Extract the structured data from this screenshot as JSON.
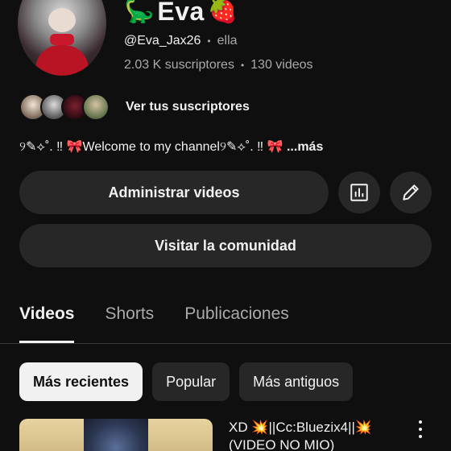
{
  "channel": {
    "name": "Eva",
    "emoji_left": "🦕",
    "emoji_right": "🍓",
    "handle": "@Eva_Jax26",
    "pronouns": "ella",
    "subscribers": "2.03 K suscriptores",
    "videos": "130 videos",
    "separator": "•"
  },
  "subscribers_preview": {
    "link_label": "Ver tus suscriptores"
  },
  "description": {
    "text": "୨✎⟡˚. ‼ 🎀Welcome to my channel୨✎⟡˚. ‼ 🎀",
    "more_label": "...más"
  },
  "buttons": {
    "manage": "Administrar videos",
    "analytics_icon": "analytics-icon",
    "edit_icon": "pencil-icon",
    "community": "Visitar la comunidad"
  },
  "tabs": [
    {
      "label": "Videos",
      "active": true
    },
    {
      "label": "Shorts",
      "active": false
    },
    {
      "label": "Publicaciones",
      "active": false
    }
  ],
  "chips": [
    {
      "label": "Más recientes",
      "active": true
    },
    {
      "label": "Popular",
      "active": false
    },
    {
      "label": "Más antiguos",
      "active": false
    }
  ],
  "videos": [
    {
      "title": "XD 💥||Cc:Bluezix4||💥 (VIDEO NO MIO)"
    }
  ],
  "colors": {
    "background": "#0f0f0f",
    "button": "#272727",
    "text": "#f1f1f1",
    "muted": "#aaaaaa"
  }
}
